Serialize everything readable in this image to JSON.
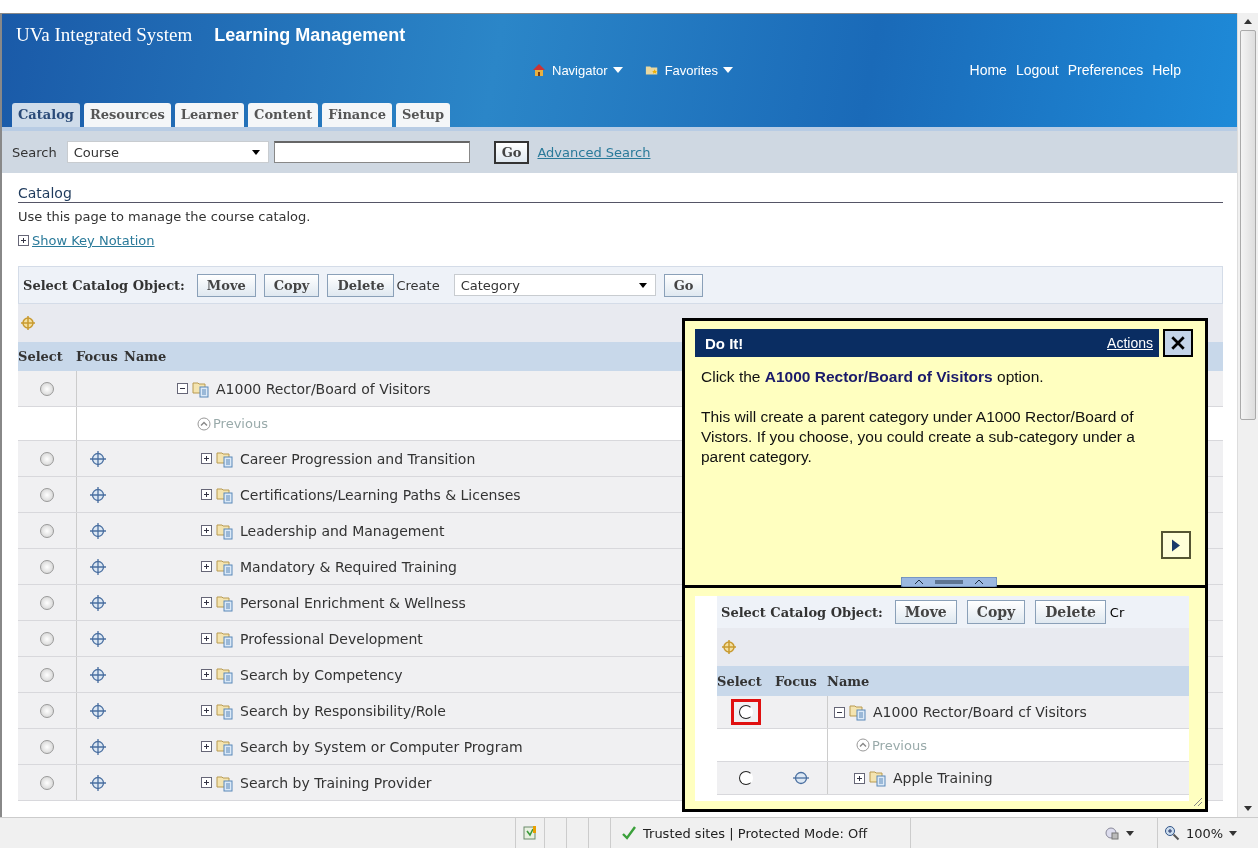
{
  "header": {
    "brand": "UVa Integrated System",
    "app": "Learning Management",
    "global_menus": [
      {
        "label": "Navigator",
        "kind": "home"
      },
      {
        "label": "Favorites",
        "kind": "favorites"
      }
    ],
    "links": [
      "Home",
      "Logout",
      "Preferences",
      "Help"
    ]
  },
  "tabs": [
    {
      "label": "Catalog",
      "selected": true
    },
    {
      "label": "Resources",
      "selected": false
    },
    {
      "label": "Learner",
      "selected": false
    },
    {
      "label": "Content",
      "selected": false
    },
    {
      "label": "Finance",
      "selected": false
    },
    {
      "label": "Setup",
      "selected": false
    }
  ],
  "search": {
    "label": "Search",
    "scope": "Course",
    "button": "Go",
    "advanced": "Advanced Search"
  },
  "page": {
    "title": "Catalog",
    "description": "Use this page to manage the course catalog.",
    "key_notation": "Show Key Notation"
  },
  "toolbar": {
    "label": "Select Catalog Object:",
    "buttons": [
      "Move",
      "Copy",
      "Delete"
    ],
    "create_label": "Create",
    "create_value": "Category",
    "go": "Go"
  },
  "table": {
    "columns": [
      "Select",
      "Focus",
      "Name"
    ],
    "previous": "Previous",
    "tree": {
      "name": "A1000 Rector/Board of Visitors",
      "expanded": true,
      "selected": false,
      "children": [
        {
          "name": "Career Progression and Transition",
          "expanded": false,
          "selected": false
        },
        {
          "name": "Certifications/Learning Paths & Licenses",
          "expanded": false,
          "selected": false
        },
        {
          "name": "Leadership and Management",
          "expanded": false,
          "selected": false
        },
        {
          "name": "Mandatory & Required Training",
          "expanded": false,
          "selected": false
        },
        {
          "name": "Personal Enrichment & Wellness",
          "expanded": false,
          "selected": false
        },
        {
          "name": "Professional Development",
          "expanded": false,
          "selected": false
        },
        {
          "name": "Search by Competency",
          "expanded": false,
          "selected": false
        },
        {
          "name": "Search by Responsibility/Role",
          "expanded": false,
          "selected": false
        },
        {
          "name": "Search by System or Computer Program",
          "expanded": false,
          "selected": false
        },
        {
          "name": "Search by Training Provider",
          "expanded": false,
          "selected": false
        }
      ]
    }
  },
  "do_it": {
    "title": "Do It!",
    "actions": "Actions",
    "instruction": "Click the **A1000 Rector/Board of Visitors** option.",
    "detail": "This will create a parent category under A1000 Rector/Board of Vistors. If you choose, you could create a sub-category under a parent category.",
    "preview": {
      "toolbar_label": "Select Catalog Object:",
      "buttons": [
        "Move",
        "Copy",
        "Delete"
      ],
      "create_cut": "Cr",
      "columns": [
        "Select",
        "Focus",
        "Name"
      ],
      "previous": "Previous",
      "tree": {
        "name": "A1000 Rector/Board cf Visitors",
        "expanded": true,
        "highlighted": true,
        "children": [
          {
            "name": "Apple Training",
            "expanded": false,
            "highlighted": false
          }
        ]
      }
    }
  },
  "status_bar": {
    "zone": "Trusted sites | Protected Mode: Off",
    "zoom": "100%"
  }
}
